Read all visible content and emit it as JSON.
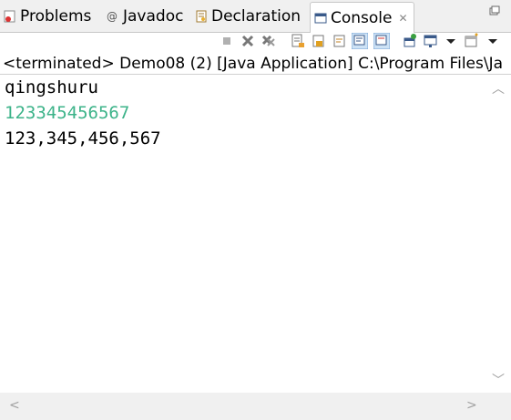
{
  "tabs": [
    {
      "label": "Problems",
      "icon": "problems-icon"
    },
    {
      "label": "Javadoc",
      "icon": "at-icon"
    },
    {
      "label": "Declaration",
      "icon": "declaration-icon"
    },
    {
      "label": "Console",
      "icon": "console-icon",
      "active": true
    }
  ],
  "status_line": "<terminated> Demo08 (2) [Java Application] C:\\Program Files\\Ja",
  "console_lines": [
    {
      "text": "qingshuru",
      "color": "#000000"
    },
    {
      "text": "123345456567",
      "color": "#3cb389"
    },
    {
      "text": "123,345,456,567",
      "color": "#000000"
    }
  ],
  "colors": {
    "input_green": "#3cb389"
  }
}
